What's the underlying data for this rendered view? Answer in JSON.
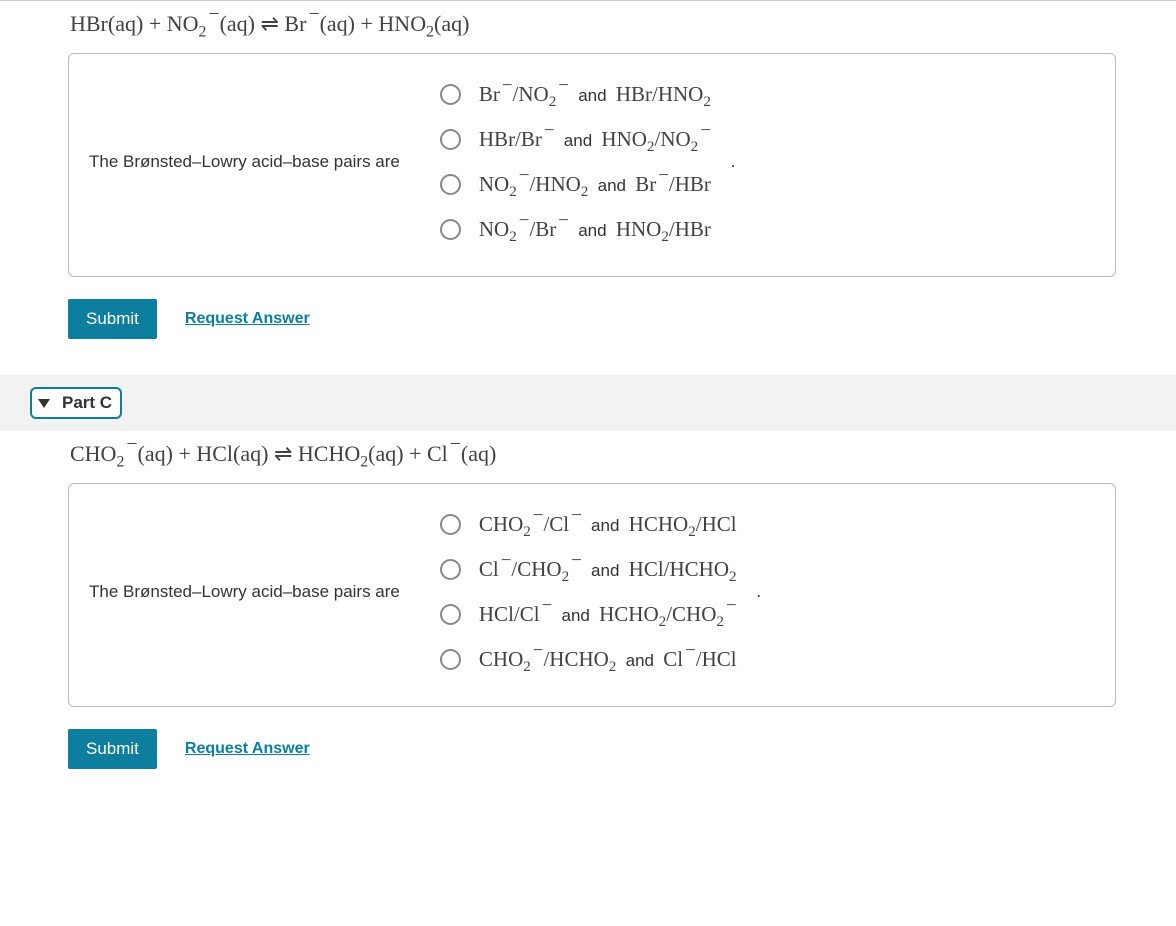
{
  "partB": {
    "equation_html": "HBr(aq) + NO<span class='sub'>2</span><span class='minus'>−</span>(aq) &#8652; Br<span class='minus'>−</span>(aq) + HNO<span class='sub'>2</span>(aq)",
    "prompt": "The Brønsted–Lowry acid–base pairs are",
    "choices": [
      "Br<span class='minus'>−</span>/NO<span class='sub'>2</span><span class='minus'>−</span> <span class='andword'>and</span> HBr/HNO<span class='sub'>2</span>",
      "HBr/Br<span class='minus'>−</span> <span class='andword'>and</span> HNO<span class='sub'>2</span>/NO<span class='sub'>2</span><span class='minus'>−</span>",
      "NO<span class='sub'>2</span><span class='minus'>−</span>/HNO<span class='sub'>2</span> <span class='andword'>and</span> Br<span class='minus'>−</span>/HBr",
      "NO<span class='sub'>2</span><span class='minus'>−</span>/Br<span class='minus'>−</span> <span class='andword'>and</span> HNO<span class='sub'>2</span>/HBr"
    ],
    "submit": "Submit",
    "request": "Request Answer"
  },
  "partC": {
    "label": "Part C",
    "equation_html": "CHO<span class='sub'>2</span><span class='minus'>−</span>(aq) + HCl(aq) &#8652; HCHO<span class='sub'>2</span>(aq) + Cl<span class='minus'>−</span>(aq)",
    "prompt": "The Brønsted–Lowry acid–base pairs are",
    "choices": [
      "CHO<span class='sub'>2</span><span class='minus'>−</span>/Cl<span class='minus'>−</span> <span class='andword'>and</span> HCHO<span class='sub'>2</span>/HCl",
      "Cl<span class='minus'>−</span>/CHO<span class='sub'>2</span><span class='minus'>−</span> <span class='andword'>and</span> HCl/HCHO<span class='sub'>2</span>",
      "HCl/Cl<span class='minus'>−</span> <span class='andword'>and</span> HCHO<span class='sub'>2</span>/CHO<span class='sub'>2</span><span class='minus'>−</span>",
      "CHO<span class='sub'>2</span><span class='minus'>−</span>/HCHO<span class='sub'>2</span> <span class='andword'>and</span> Cl<span class='minus'>−</span>/HCl"
    ],
    "submit": "Submit",
    "request": "Request Answer"
  }
}
